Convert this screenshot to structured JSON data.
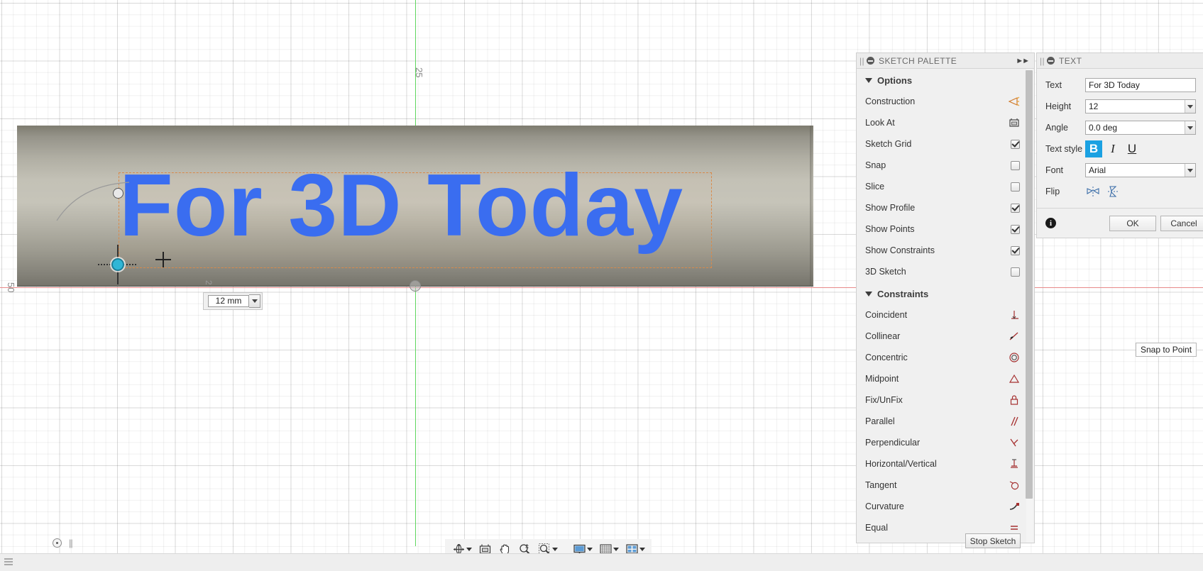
{
  "canvas": {
    "sketch_text": "For 3D Today",
    "grid_labels": {
      "v25": "25",
      "h50": "50",
      "small2": "2"
    },
    "dimension_value": "12 mm",
    "body_color": "#c3c1b6",
    "text_color": "#3a6df0"
  },
  "sketch_palette": {
    "title": "SKETCH PALETTE",
    "expand_icon": "double-chevron-right-icon",
    "sections": [
      {
        "name": "Options",
        "rows": [
          {
            "label": "Construction",
            "control": "icon",
            "icon": "construction-icon",
            "checked": false
          },
          {
            "label": "Look At",
            "control": "icon",
            "icon": "look-at-icon",
            "checked": false
          },
          {
            "label": "Sketch Grid",
            "control": "checkbox",
            "icon": "checkbox-icon",
            "checked": true
          },
          {
            "label": "Snap",
            "control": "checkbox",
            "icon": "checkbox-icon",
            "checked": false
          },
          {
            "label": "Slice",
            "control": "checkbox",
            "icon": "checkbox-icon",
            "checked": false
          },
          {
            "label": "Show Profile",
            "control": "checkbox",
            "icon": "checkbox-icon",
            "checked": true
          },
          {
            "label": "Show Points",
            "control": "checkbox",
            "icon": "checkbox-icon",
            "checked": true
          },
          {
            "label": "Show Constraints",
            "control": "checkbox",
            "icon": "checkbox-icon",
            "checked": true
          },
          {
            "label": "3D Sketch",
            "control": "checkbox",
            "icon": "checkbox-icon",
            "checked": false
          }
        ]
      },
      {
        "name": "Constraints",
        "rows": [
          {
            "label": "Coincident",
            "control": "icon",
            "icon": "coincident-constraint-icon"
          },
          {
            "label": "Collinear",
            "control": "icon",
            "icon": "collinear-constraint-icon"
          },
          {
            "label": "Concentric",
            "control": "icon",
            "icon": "concentric-constraint-icon"
          },
          {
            "label": "Midpoint",
            "control": "icon",
            "icon": "midpoint-constraint-icon"
          },
          {
            "label": "Fix/UnFix",
            "control": "icon",
            "icon": "fix-unfix-constraint-icon"
          },
          {
            "label": "Parallel",
            "control": "icon",
            "icon": "parallel-constraint-icon"
          },
          {
            "label": "Perpendicular",
            "control": "icon",
            "icon": "perpendicular-constraint-icon"
          },
          {
            "label": "Horizontal/Vertical",
            "control": "icon",
            "icon": "horizontal-vertical-constraint-icon"
          },
          {
            "label": "Tangent",
            "control": "icon",
            "icon": "tangent-constraint-icon"
          },
          {
            "label": "Curvature",
            "control": "icon",
            "icon": "curvature-constraint-icon"
          },
          {
            "label": "Equal",
            "control": "icon",
            "icon": "equal-constraint-icon"
          }
        ]
      }
    ]
  },
  "text_dialog": {
    "title": "TEXT",
    "fields": {
      "text_label": "Text",
      "text_value": "For 3D Today",
      "height_label": "Height",
      "height_value": "12",
      "angle_label": "Angle",
      "angle_value": "0.0 deg",
      "style_label": "Text style",
      "font_label": "Font",
      "font_value": "Arial",
      "flip_label": "Flip"
    },
    "style_buttons": [
      {
        "glyph": "B",
        "name": "bold-button",
        "active": true
      },
      {
        "glyph": "I",
        "name": "italic-button",
        "active": false
      },
      {
        "glyph": "U",
        "name": "underline-button",
        "active": false
      }
    ],
    "flip_buttons": [
      {
        "name": "flip-horizontal-icon"
      },
      {
        "name": "flip-vertical-icon"
      }
    ],
    "ok_label": "OK",
    "cancel_label": "Cancel",
    "accent_color": "#1ba1e2"
  },
  "tooltip": {
    "text": "Snap to Point"
  },
  "nav_toolbar": {
    "items": [
      {
        "name": "orbit-icon",
        "has_caret": true
      },
      {
        "name": "look-at-icon",
        "has_caret": false
      },
      {
        "name": "pan-icon",
        "has_caret": false
      },
      {
        "name": "zoom-icon",
        "has_caret": false
      },
      {
        "name": "zoom-window-icon",
        "has_caret": true
      },
      {
        "name": "display-settings-icon",
        "has_caret": true
      },
      {
        "name": "grid-snap-icon",
        "has_caret": true
      },
      {
        "name": "viewports-icon",
        "has_caret": true
      }
    ]
  },
  "stop_sketch": {
    "label": "Stop Sketch"
  }
}
